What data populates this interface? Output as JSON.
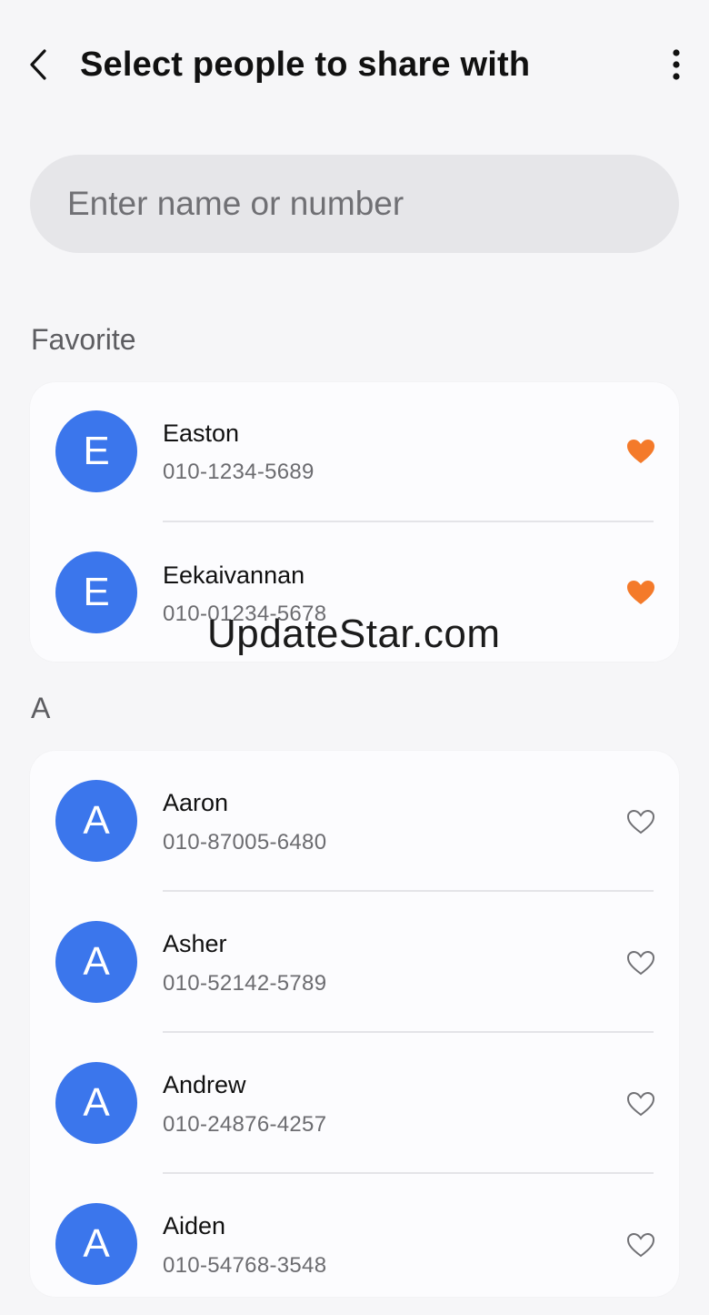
{
  "header": {
    "title": "Select people to share with",
    "back_icon": "chevron-left-icon",
    "more_icon": "more-vertical-icon"
  },
  "search": {
    "placeholder": "Enter name or number",
    "value": ""
  },
  "sections": [
    {
      "label": "Favorite",
      "contacts": [
        {
          "initial": "E",
          "name": "Easton",
          "phone": "010-1234-5689",
          "favorite": true
        },
        {
          "initial": "E",
          "name": "Eekaivannan",
          "phone": "010-01234-5678",
          "favorite": true
        }
      ]
    },
    {
      "label": "A",
      "contacts": [
        {
          "initial": "A",
          "name": "Aaron",
          "phone": "010-87005-6480",
          "favorite": false
        },
        {
          "initial": "A",
          "name": "Asher",
          "phone": "010-52142-5789",
          "favorite": false
        },
        {
          "initial": "A",
          "name": "Andrew",
          "phone": "010-24876-4257",
          "favorite": false
        },
        {
          "initial": "A",
          "name": "Aiden",
          "phone": "010-54768-3548",
          "favorite": false
        }
      ]
    }
  ],
  "watermark": "UpdateStar.com",
  "colors": {
    "avatar": "#3b76ec",
    "favorite_heart": "#f47a2a",
    "background": "#f6f6f8"
  }
}
